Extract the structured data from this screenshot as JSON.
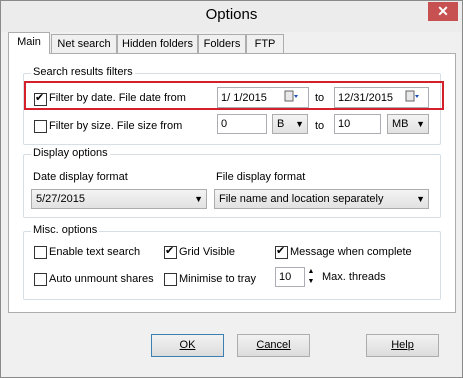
{
  "window": {
    "title": "Options",
    "close_glyph": "✕"
  },
  "tabs": [
    {
      "label": "Main"
    },
    {
      "label": "Net search"
    },
    {
      "label": "Hidden folders"
    },
    {
      "label": "Folders"
    },
    {
      "label": "FTP"
    }
  ],
  "search_filters": {
    "group_label": "Search results filters",
    "date_filter": {
      "label": "Filter by date. File date from",
      "checked": true,
      "from": "1/  1/2015",
      "to_label": "to",
      "to": "12/31/2015"
    },
    "size_filter": {
      "label": "Filter by size. File size from",
      "checked": false,
      "from": "0",
      "from_unit": "B",
      "to_label": "to",
      "to": "10",
      "to_unit": "MB"
    }
  },
  "display_options": {
    "group_label": "Display options",
    "date_format_label": "Date display format",
    "date_format_value": "5/27/2015",
    "file_format_label": "File display format",
    "file_format_value": "File name and location separately"
  },
  "misc_options": {
    "group_label": "Misc. options",
    "enable_text_search": {
      "label": "Enable text search",
      "checked": false
    },
    "grid_visible": {
      "label": "Grid Visible",
      "checked": true
    },
    "message_when_complete": {
      "label": "Message when complete",
      "checked": true
    },
    "auto_unmount": {
      "label": "Auto unmount shares",
      "checked": false
    },
    "minimise_to_tray": {
      "label": "Minimise to tray",
      "checked": false
    },
    "max_threads": {
      "value": "10",
      "label": "Max. threads"
    }
  },
  "buttons": {
    "ok": "OK",
    "cancel": "Cancel",
    "help": "Help"
  },
  "colors": {
    "highlight": "#d4202a",
    "close_button": "#c75050"
  }
}
